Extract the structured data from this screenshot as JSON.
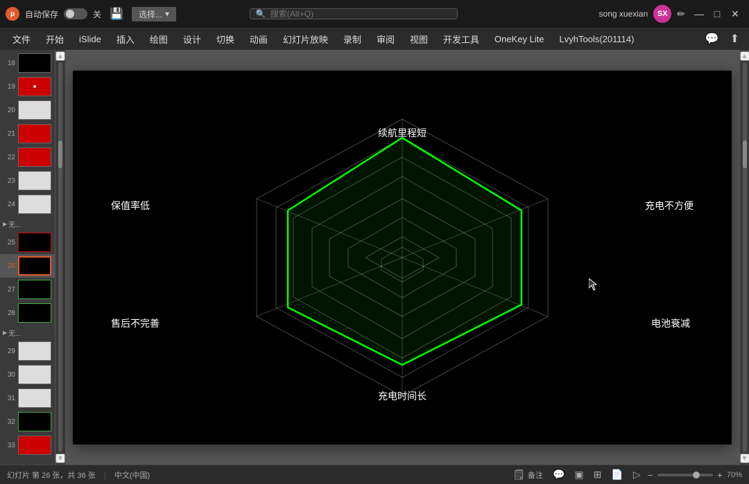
{
  "titlebar": {
    "logo_text": "p",
    "autosave_label": "自动保存",
    "toggle_state": "关",
    "select_label": "选择...",
    "search_placeholder": "搜索(Alt+Q)",
    "username": "song xuexian",
    "avatar_initials": "SX",
    "minimize": "—",
    "restore": "□",
    "close": "✕"
  },
  "menubar": {
    "items": [
      "文件",
      "开始",
      "iSlide",
      "插入",
      "绘图",
      "设计",
      "切换",
      "动画",
      "幻灯片放映",
      "录制",
      "审阅",
      "视图",
      "开发工具",
      "OneKey Lite",
      "LvyhTools(201114)"
    ]
  },
  "slides": [
    {
      "num": "18",
      "active": false
    },
    {
      "num": "19",
      "active": false
    },
    {
      "num": "20",
      "active": false
    },
    {
      "num": "21",
      "active": false
    },
    {
      "num": "22",
      "active": false
    },
    {
      "num": "23",
      "active": false
    },
    {
      "num": "24",
      "active": false
    },
    {
      "num": "25",
      "active": false,
      "section": "无..."
    },
    {
      "num": "26",
      "active": true
    },
    {
      "num": "27",
      "active": false
    },
    {
      "num": "28",
      "active": false
    },
    {
      "num": "29",
      "active": false,
      "section": "无..."
    },
    {
      "num": "30",
      "active": false
    },
    {
      "num": "31",
      "active": false
    },
    {
      "num": "32",
      "active": false
    },
    {
      "num": "33",
      "active": false
    }
  ],
  "radar": {
    "labels": {
      "top": "续航里程短",
      "top_right": "充电不方便",
      "bottom_right": "电池衰减",
      "bottom": "充电时间长",
      "bottom_left": "售后不完善",
      "top_left": "保值率低"
    }
  },
  "statusbar": {
    "slide_info": "幻灯片 第 26 张，共 36 张",
    "language": "中文(中国)",
    "notes_label": "备注",
    "zoom_percent": "70%"
  }
}
